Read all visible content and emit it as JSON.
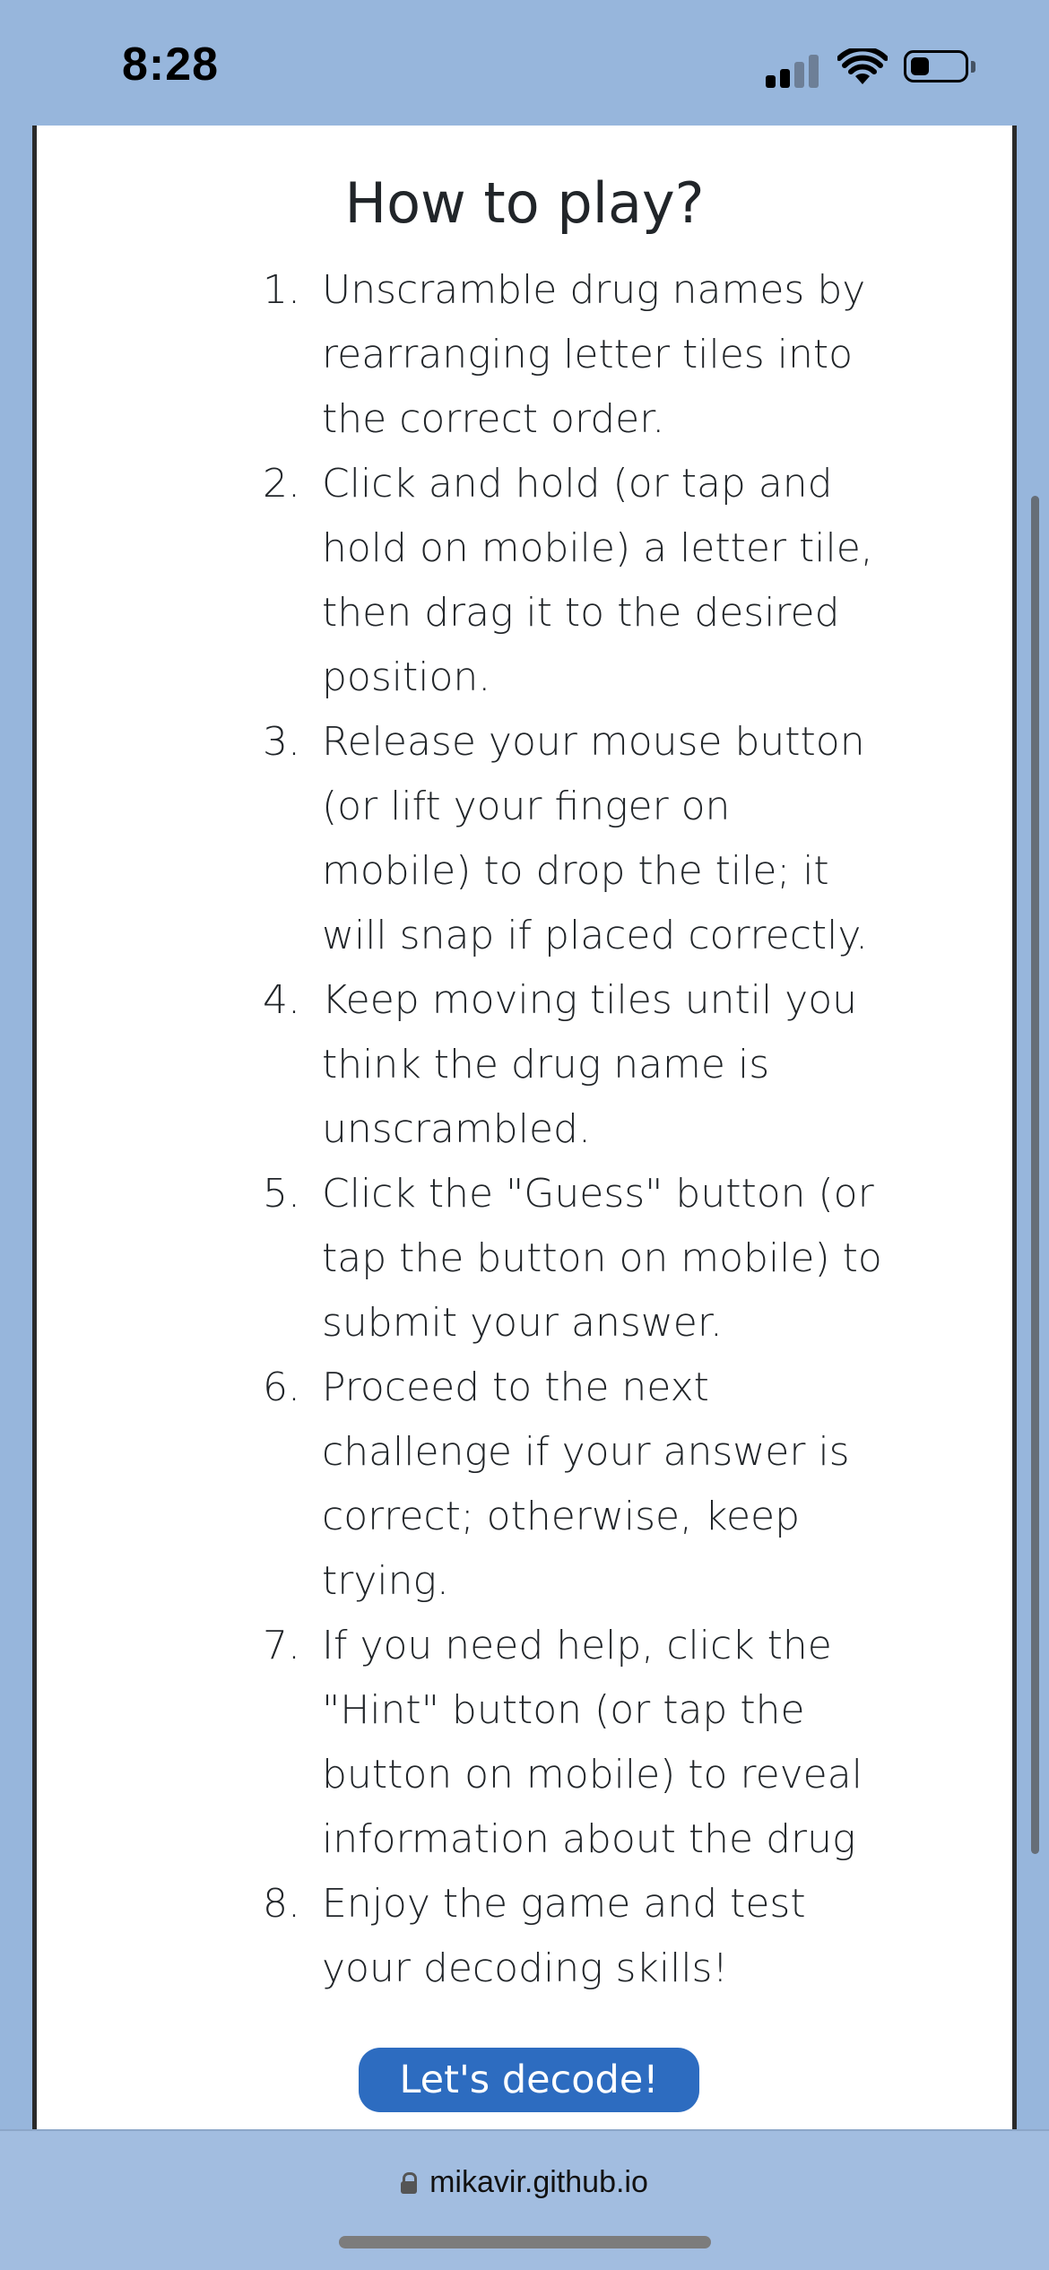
{
  "status_bar": {
    "time": "8:28",
    "signal_icon": "cellular-signal-icon",
    "wifi_icon": "wifi-icon",
    "battery_icon": "battery-icon",
    "battery_level_fraction": 0.25
  },
  "modal": {
    "title": "How to play?",
    "steps": [
      {
        "num": "1.",
        "text": "Unscramble drug names by rearranging letter tiles into the correct order."
      },
      {
        "num": "2.",
        "text": "Click and hold (or tap and hold on mobile) a letter tile, then drag it to the desired position."
      },
      {
        "num": "3.",
        "text": "Release your mouse button (or lift your finger on mobile) to drop the tile; it will snap if placed correctly."
      },
      {
        "num": "4.",
        "text": "Keep moving tiles until you think the drug name is unscrambled."
      },
      {
        "num": "5.",
        "text": "Click the \"Guess\" button (or tap the button on mobile) to submit your answer."
      },
      {
        "num": "6.",
        "text": "Proceed to the next challenge if your answer is correct; otherwise, keep trying."
      },
      {
        "num": "7.",
        "text": "If you need help, click the \"Hint\" button (or tap the button on mobile) to reveal information about the drug"
      },
      {
        "num": "8.",
        "text": "Enjoy the game and test your decoding skills!"
      }
    ],
    "button_label": "Let's decode!"
  },
  "browser": {
    "url": "mikavir.github.io",
    "lock_icon": "lock-icon"
  },
  "colors": {
    "background": "#97b6dc",
    "modal_background": "#ffffff",
    "button": "#2d6cc0",
    "text": "#212529"
  }
}
